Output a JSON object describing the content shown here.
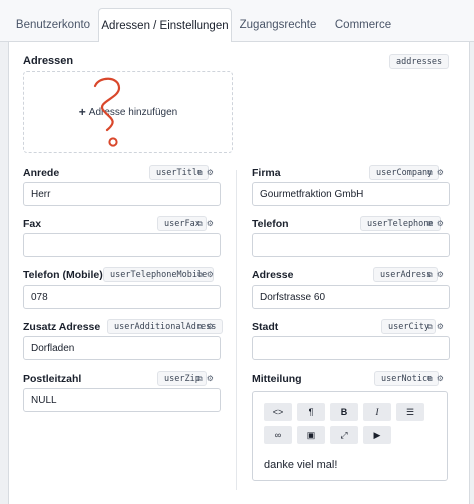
{
  "tabs": [
    {
      "label": "Benutzerkonto"
    },
    {
      "label": "Adressen / Einstellungen"
    },
    {
      "label": "Zugangsrechte"
    },
    {
      "label": "Commerce"
    }
  ],
  "addresses": {
    "label": "Adressen",
    "key": "addresses",
    "add_label": "Adresse hinzufügen"
  },
  "fields": {
    "anrede": {
      "label": "Anrede",
      "key": "userTitle",
      "value": "Herr"
    },
    "firma": {
      "label": "Firma",
      "key": "userCompany",
      "value": "Gourmetfraktion GmbH"
    },
    "fax": {
      "label": "Fax",
      "key": "userFax",
      "value": ""
    },
    "telefon": {
      "label": "Telefon",
      "key": "userTelephone",
      "value": ""
    },
    "mobile": {
      "label": "Telefon (Mobile)",
      "key": "userTelephoneMobile",
      "value": "078"
    },
    "adresse": {
      "label": "Adresse",
      "key": "userAdress",
      "value": "Dorfstrasse 60"
    },
    "zusatz": {
      "label": "Zusatz Adresse",
      "key": "userAdditionalAdress",
      "value": "Dorfladen"
    },
    "stadt": {
      "label": "Stadt",
      "key": "userCity",
      "value": ""
    },
    "plz": {
      "label": "Postleitzahl",
      "key": "userZip",
      "value": "NULL"
    },
    "mitteilung": {
      "label": "Mitteilung",
      "key": "userNotice",
      "value": "danke viel mal!"
    }
  },
  "editor_toolbar": [
    {
      "icon": "code-icon",
      "glyph": "<>"
    },
    {
      "icon": "paragraph-icon",
      "glyph": "¶"
    },
    {
      "icon": "bold-icon",
      "glyph": "B"
    },
    {
      "icon": "italic-icon",
      "glyph": "I"
    },
    {
      "icon": "list-icon",
      "glyph": "☰"
    },
    {
      "icon": "link-icon",
      "glyph": "∞"
    },
    {
      "icon": "image-icon",
      "glyph": "▣"
    },
    {
      "icon": "fullscreen-icon",
      "glyph": "⤢"
    },
    {
      "icon": "video-icon",
      "glyph": "▶"
    }
  ],
  "mini_icons": {
    "copy": "⧉",
    "settings": "⚙"
  },
  "colors": {
    "annotation_red": "#d9472b"
  }
}
